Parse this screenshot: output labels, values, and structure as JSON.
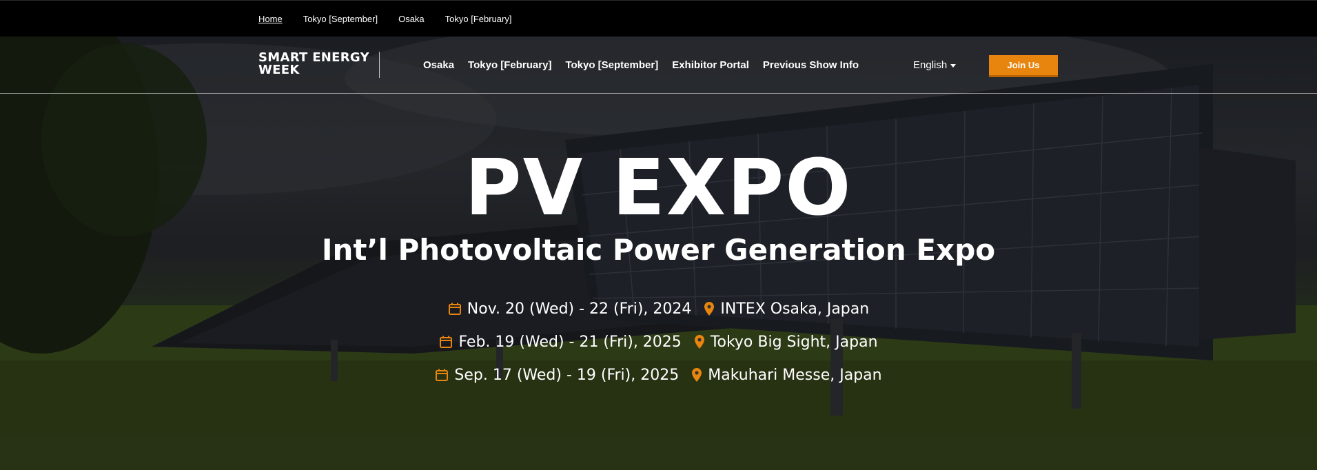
{
  "topbar": {
    "links": [
      {
        "label": "Home",
        "active": true
      },
      {
        "label": "Tokyo [September]",
        "active": false
      },
      {
        "label": "Osaka",
        "active": false
      },
      {
        "label": "Tokyo [February]",
        "active": false
      }
    ]
  },
  "header": {
    "logo_line1": "SMART ENERGY",
    "logo_line2": "WEEK",
    "nav": [
      "Osaka",
      "Tokyo [February]",
      "Tokyo [September]",
      "Exhibitor Portal",
      "Previous Show Info"
    ],
    "language": "English",
    "join_label": "Join Us"
  },
  "hero": {
    "title": "PV EXPO",
    "subtitle": "Int’l Photovoltaic Power Generation Expo",
    "events": [
      {
        "date": "Nov. 20 (Wed) - 22 (Fri), 2024",
        "place": "INTEX Osaka, Japan"
      },
      {
        "date": "Feb. 19 (Wed) - 21 (Fri), 2025",
        "place": "Tokyo Big Sight, Japan"
      },
      {
        "date": "Sep. 17 (Wed) - 19 (Fri), 2025",
        "place": "Makuhari Messe, Japan"
      }
    ]
  },
  "colors": {
    "accent": "#e8850e",
    "topbar_bg": "#000000",
    "text": "#ffffff"
  },
  "icons": {
    "calendar": "calendar-icon",
    "location": "map-pin-icon",
    "language_caret": "chevron-down-icon"
  }
}
